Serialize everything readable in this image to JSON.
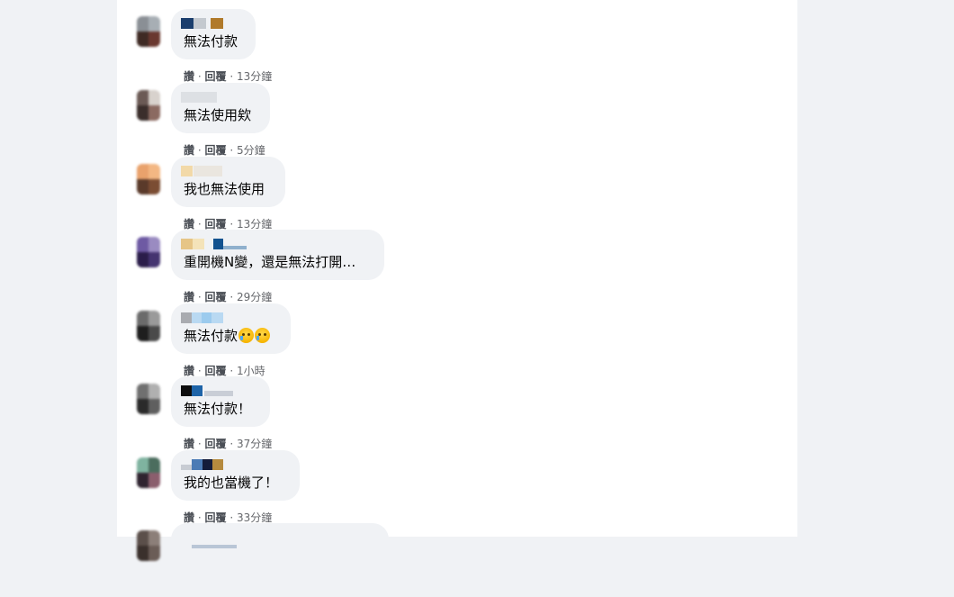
{
  "comments": [
    {
      "text": "無法付款",
      "like": "讚",
      "reply": "回覆",
      "time": "13分鐘",
      "avatar_colors": [
        "#8a8f95",
        "#a7aeb4",
        "#3f2a24",
        "#6a3830"
      ],
      "name_colors": [
        "#1b3e6d",
        "#c4c9cf",
        "#b07a2a",
        "#d9d9d9"
      ]
    },
    {
      "text": "無法使用欸",
      "like": "讚",
      "reply": "回覆",
      "time": "5分鐘",
      "avatar_colors": [
        "#6b5a55",
        "#d8d2cd",
        "#3a2e2b",
        "#8b6a61"
      ],
      "name_colors": [
        "#d0d3d8",
        "#e1e4e8",
        "#b9c4d3",
        "#d0d3d8"
      ]
    },
    {
      "text": "我也無法使用",
      "like": "讚",
      "reply": "回覆",
      "time": "13分鐘",
      "avatar_colors": [
        "#e9a26c",
        "#f3b783",
        "#5a3a2a",
        "#7b4d33"
      ],
      "name_colors": [
        "#f2d9a8",
        "#e7e1d6",
        "#d6dbe1",
        "#e6e6e6"
      ]
    },
    {
      "text": "重開機N變，還是無法打開…",
      "like": "讚",
      "reply": "回覆",
      "time": "29分鐘",
      "avatar_colors": [
        "#6e5aa3",
        "#9a8bc1",
        "#2b1d4a",
        "#453470"
      ],
      "name_colors": [
        "#e6c586",
        "#f4e3b9",
        "#12528f",
        "#8fb0cd"
      ]
    },
    {
      "text": "無法付款",
      "emoji": [
        "crying-face",
        "crying-face"
      ],
      "like": "讚",
      "reply": "回覆",
      "time": "1小時",
      "avatar_colors": [
        "#6b6b6b",
        "#9a9a9a",
        "#1e1e1e",
        "#4a4a4a"
      ],
      "name_colors": [
        "#8a8d93",
        "#b9d9f2",
        "#9ccbee",
        "#b9d9f2"
      ]
    },
    {
      "text": "無法付款！",
      "like": "讚",
      "reply": "回覆",
      "time": "37分鐘",
      "avatar_colors": [
        "#707070",
        "#b0b0b0",
        "#2a2a2a",
        "#5f5f5f"
      ],
      "name_colors": [
        "#0e0e0e",
        "#1e64a8",
        "#c9ced6",
        "#c9ced6"
      ]
    },
    {
      "text": "我的也當機了！",
      "like": "讚",
      "reply": "回覆",
      "time": "33分鐘",
      "avatar_colors": [
        "#7fb3a0",
        "#4b6d5e",
        "#2f2430",
        "#8b5e6d"
      ],
      "name_colors": [
        "#c8ccd3",
        "#4b7bb5",
        "#141c3a",
        "#b58a3e"
      ]
    },
    {
      "text": "",
      "like": "",
      "reply": "",
      "time": "",
      "avatar_colors": [
        "#5b4f4a",
        "#8c7f79",
        "#3a302c",
        "#6b5d57"
      ],
      "name_colors": [
        "#d0d3d8",
        "#e1e4e8",
        "#d0d3d8",
        "#e1e4e8"
      ]
    }
  ],
  "separator": "·"
}
